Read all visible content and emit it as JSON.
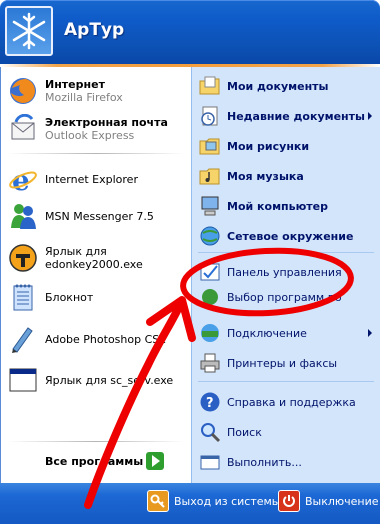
{
  "header": {
    "username": "АрТур"
  },
  "left": {
    "pinned": [
      {
        "title": "Интернет",
        "subtitle": "Mozilla Firefox",
        "icon": "firefox-icon"
      },
      {
        "title": "Электронная почта",
        "subtitle": "Outlook Express",
        "icon": "outlook-express-icon"
      }
    ],
    "recent": [
      {
        "label": "Internet Explorer",
        "icon": "internet-explorer-icon"
      },
      {
        "label": "MSN Messenger 7.5",
        "icon": "msn-messenger-icon"
      },
      {
        "label": "Ярлык для edonkey2000.exe",
        "icon": "edonkey-icon"
      },
      {
        "label": "Блокнот",
        "icon": "notepad-icon"
      },
      {
        "label": "Adobe Photoshop CS2",
        "icon": "photoshop-icon"
      },
      {
        "label": "Ярлык для sc_serv.exe",
        "icon": "window-app-icon"
      }
    ],
    "all_programs": "Все программы"
  },
  "right": {
    "items": [
      {
        "label": "Мои документы"
      },
      {
        "label": "Недавние документы"
      },
      {
        "label": "Мои рисунки"
      },
      {
        "label": "Моя музыка"
      },
      {
        "label": "Мой компьютер"
      },
      {
        "label": "Сетевое окружение"
      },
      {
        "label": "Панель управления"
      },
      {
        "label": "Выбор программ по"
      },
      {
        "label": "Подключение"
      },
      {
        "label": "Принтеры и факсы"
      },
      {
        "label": "Справка и поддержка"
      },
      {
        "label": "Поиск"
      },
      {
        "label": "Выполнить..."
      }
    ]
  },
  "footer": {
    "logoff": "Выход из системы",
    "shutdown": "Выключение"
  },
  "colors": {
    "header_blue": "#0e5bc9",
    "right_panel": "#d3e5fa",
    "annotation_red": "#ee0000",
    "green_arrow": "#2e9e2e"
  }
}
